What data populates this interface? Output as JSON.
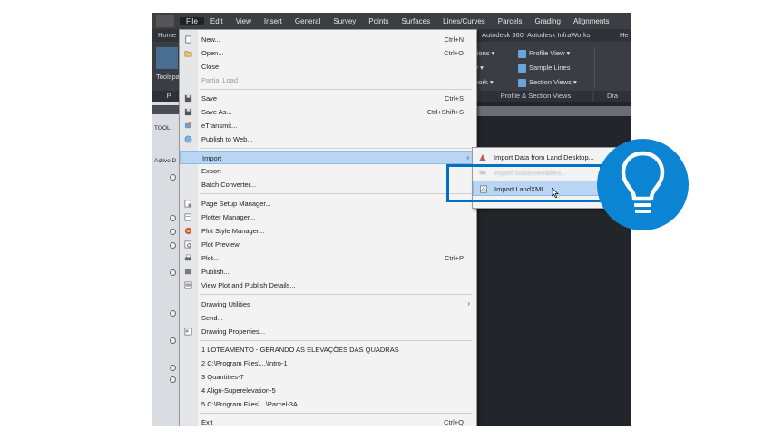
{
  "menubar": {
    "items": [
      "File",
      "Edit",
      "View",
      "Insert",
      "General",
      "Survey",
      "Points",
      "Surfaces",
      "Lines/Curves",
      "Parcels",
      "Grading",
      "Alignments"
    ]
  },
  "ribbon": {
    "tabs": {
      "left": "Home",
      "autodesk360": "Autodesk 360",
      "infraworks": "Autodesk InfraWorks",
      "more": "He"
    },
    "left_tool": "Toolspa",
    "frag1": "ctions ▾",
    "frag2": "ily ▾",
    "frag3": "twork ▾",
    "profile_view": "Profile View ▾",
    "sample_lines": "Sample Lines",
    "section_views": "Section Views ▾",
    "group_label_left": "P",
    "group_label": "Profile & Section Views",
    "group_label_right": "Dra"
  },
  "leftpanel": {
    "tool": "TOOL",
    "active": "Active D"
  },
  "filemenu": {
    "items": [
      {
        "label": "New...",
        "shortcut": "Ctrl+N"
      },
      {
        "label": "Open...",
        "shortcut": "Ctrl+O"
      },
      {
        "label": "Close",
        "shortcut": ""
      },
      {
        "label": "Partial Load",
        "shortcut": ""
      },
      {
        "label": "Save",
        "shortcut": "Ctrl+S"
      },
      {
        "label": "Save As...",
        "shortcut": "Ctrl+Shift+S"
      },
      {
        "label": "eTransmit...",
        "shortcut": ""
      },
      {
        "label": "Publish to Web...",
        "shortcut": ""
      },
      {
        "label": "Import",
        "shortcut": ""
      },
      {
        "label": "Export",
        "shortcut": ""
      },
      {
        "label": "Batch Converter...",
        "shortcut": ""
      },
      {
        "label": "Page Setup Manager...",
        "shortcut": ""
      },
      {
        "label": "Plotter Manager...",
        "shortcut": ""
      },
      {
        "label": "Plot Style Manager...",
        "shortcut": ""
      },
      {
        "label": "Plot Preview",
        "shortcut": ""
      },
      {
        "label": "Plot...",
        "shortcut": "Ctrl+P"
      },
      {
        "label": "Publish...",
        "shortcut": ""
      },
      {
        "label": "View Plot and Publish Details...",
        "shortcut": ""
      },
      {
        "label": "Drawing Utilities",
        "shortcut": ""
      },
      {
        "label": "Send...",
        "shortcut": ""
      },
      {
        "label": "Drawing Properties...",
        "shortcut": ""
      },
      {
        "label": "1 LOTEAMENTO - GERANDO AS ELEVAÇÕES DAS QUADRAS",
        "shortcut": ""
      },
      {
        "label": "2 C:\\Program Files\\...\\Intro-1",
        "shortcut": ""
      },
      {
        "label": "3 Quantities-7",
        "shortcut": ""
      },
      {
        "label": "4 Align-Superelevation-5",
        "shortcut": ""
      },
      {
        "label": "5 C:\\Program Files\\...\\Parcel-3A",
        "shortcut": ""
      },
      {
        "label": "Exit",
        "shortcut": "Ctrl+Q"
      }
    ]
  },
  "submenu": {
    "items": [
      {
        "label": "Import Data from Land Desktop..."
      },
      {
        "label": "Import Subassemblies..."
      },
      {
        "label": "Import LandXML..."
      }
    ]
  },
  "colors": {
    "accent": "#0072c6",
    "badge": "#0b84d3",
    "highlight": "#b8d6f3"
  },
  "icons": {
    "badge": "lightbulb-icon"
  }
}
